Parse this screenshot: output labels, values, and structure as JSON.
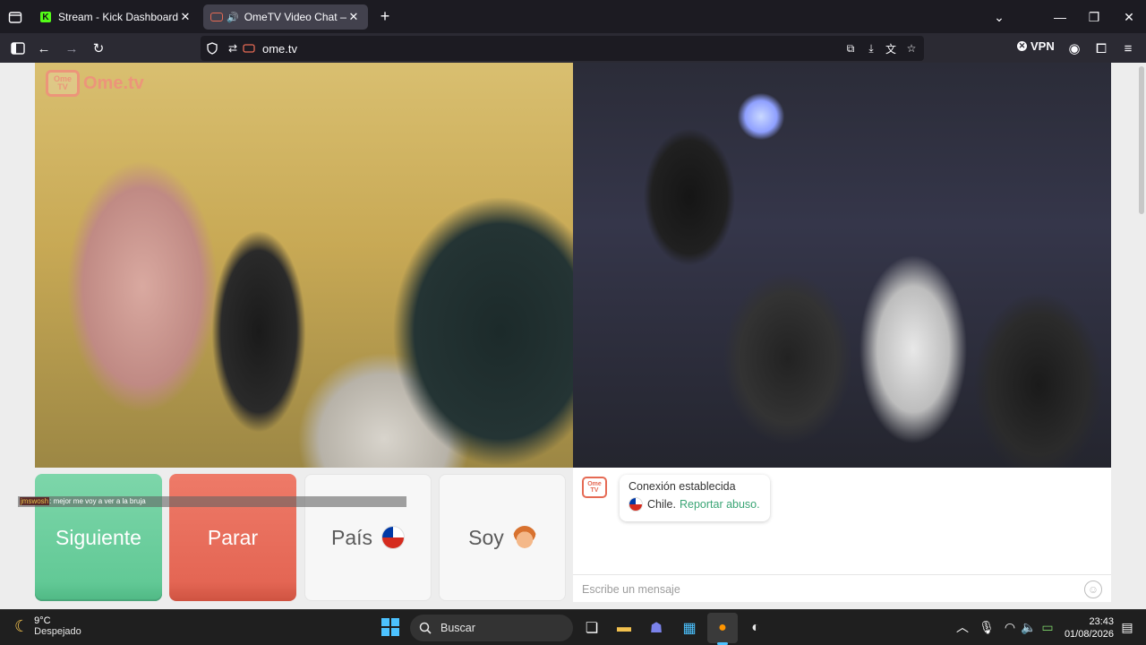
{
  "browser": {
    "tabs": [
      {
        "title": "Stream - Kick Dashboard",
        "favicon": "kick-icon",
        "active": false
      },
      {
        "title": "OmeTV Video Chat — Ome",
        "favicon": "ometv-icon",
        "active": true
      }
    ],
    "url": "ome.tv",
    "vpn_label": "VPN"
  },
  "page": {
    "logo_text": "Ome.tv",
    "logo_box": "Ome TV",
    "overlay_chat": {
      "user": "jmswosh",
      "text": ": mejor me voy a ver a la bruja"
    },
    "buttons": {
      "next": "Siguiente",
      "stop": "Parar",
      "country": "País",
      "gender": "Soy"
    },
    "chat": {
      "status": "Conexión establecida",
      "country": "Chile.",
      "report": "Reportar abuso.",
      "input_placeholder": "Escribe un mensaje"
    }
  },
  "taskbar": {
    "weather_temp": "9°C",
    "weather_desc": "Despejado",
    "search_label": "Buscar",
    "time": "23:43",
    "date": "01/08/2026"
  },
  "colors": {
    "next_green": "#62c996",
    "stop_red": "#e46654",
    "report_link": "#3aa575",
    "brand": "#e56a54"
  }
}
